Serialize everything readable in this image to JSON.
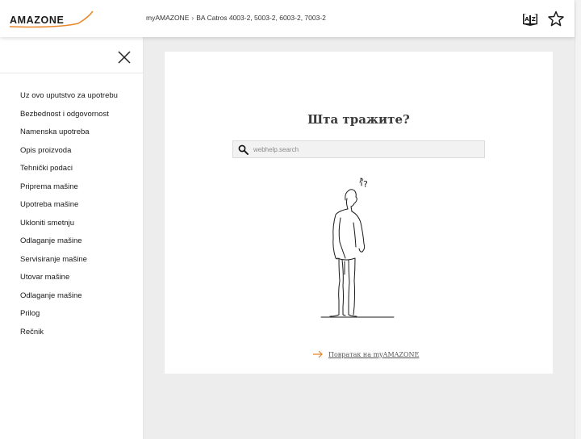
{
  "header": {
    "logo_text": "AMAZONE",
    "breadcrumb": [
      "myAMAZONE",
      "BA Catros 4003-2, 5003-2, 6003-2, 7003-2"
    ],
    "breadcrumb_separator": "›",
    "language_icon": "dictionary-az-icon",
    "favorite_icon": "star-outline-icon"
  },
  "sidebar": {
    "close_icon": "close-icon",
    "items": [
      "Uz ovo uputstvo za upotrebu",
      "Bezbednost i odgovornost",
      "Namenska upotreba",
      "Opis proizvoda",
      "Tehnički podaci",
      "Priprema mašine",
      "Upotreba mašine",
      "Ukloniti smetnju",
      "Odlaganje mašine",
      "Servisiranje mašine",
      "Utovar mašine",
      "Odlaganje mašine",
      "Prilog",
      "Rečnik"
    ]
  },
  "main": {
    "title": "Шта тражите?",
    "search": {
      "placeholder": "webhelp.search",
      "value": "",
      "icon": "search-icon"
    },
    "illustration": "person-looking-up-question-icon",
    "back_link": "Повратак на myAMAZONE",
    "back_icon": "arrow-right-icon"
  },
  "colors": {
    "brand_orange": "#e8862a",
    "text_dark": "#222222",
    "background": "#ededed",
    "card": "#ffffff"
  }
}
